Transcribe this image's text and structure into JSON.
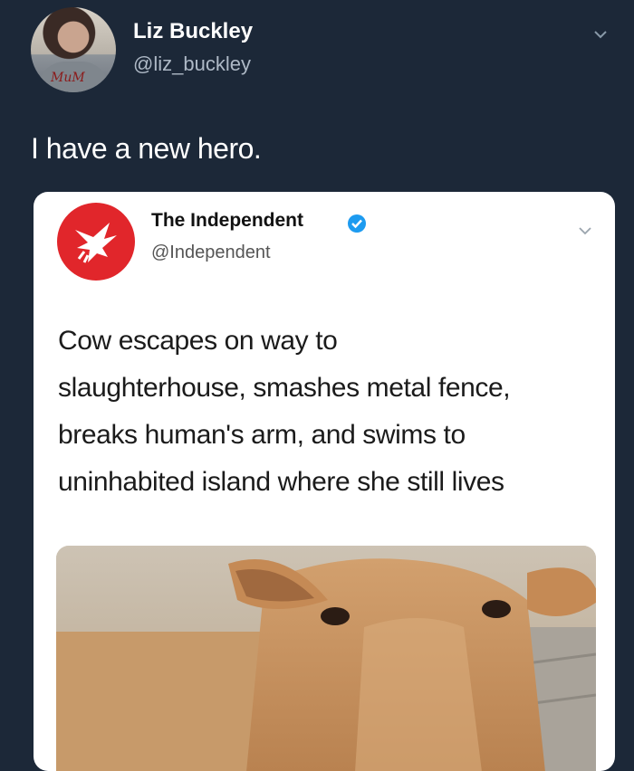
{
  "tweet": {
    "author_name": "Liz Buckley",
    "author_handle": "@liz_buckley",
    "avatar_signature": "MuM",
    "text": "I have a new hero.",
    "chevron_icon": "chevron-down-icon"
  },
  "quoted_tweet": {
    "author_name": "The Independent",
    "author_handle": "@Independent",
    "verified_icon": "verified-badge-icon",
    "logo_icon": "eagle-logo-icon",
    "chevron_icon": "chevron-down-icon",
    "text_lines": [
      "Cow escapes on way to",
      "slaughterhouse, smashes metal fence,",
      "breaks human's arm, and swims to",
      "uninhabited island where she still lives"
    ],
    "image": "cow-photo"
  },
  "colors": {
    "background": "#1c2838",
    "card": "#ffffff",
    "brand_red": "#e1262b",
    "verified_blue": "#1d9bf0"
  }
}
